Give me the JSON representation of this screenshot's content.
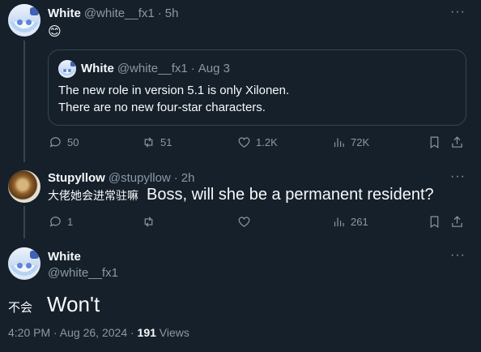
{
  "tweet1": {
    "name": "White",
    "handle": "@white__fx1",
    "separator": "·",
    "time": "5h",
    "text": "😊",
    "more": "···"
  },
  "quote": {
    "name": "White",
    "handle": "@white__fx1",
    "separator": "·",
    "time": "Aug 3",
    "line1": "The new role in version 5.1 is only Xilonen.",
    "line2": "There are no new four-star characters."
  },
  "tweet1_actions": {
    "replies": "50",
    "retweets": "51",
    "likes": "1.2K",
    "views": "72K"
  },
  "tweet2": {
    "name": "Stupyllow",
    "handle": "@stupyllow",
    "separator": "·",
    "time": "2h",
    "text_cn": "大佬她会进常驻嘛",
    "text_en": "Boss, will she be a permanent resident?",
    "more": "···"
  },
  "tweet2_actions": {
    "replies": "1",
    "retweets": "",
    "likes": "",
    "views": "261"
  },
  "main": {
    "name": "White",
    "handle": "@white__fx1",
    "text_cn": "不会",
    "text_en": "Won't",
    "more": "···",
    "timestamp": "4:20 PM · Aug 26, 2024 · ",
    "views_count": "191",
    "views_label": " Views"
  },
  "colors": {
    "background": "#15202b",
    "text": "#f7f9f9",
    "muted": "#8b98a5",
    "border": "#38444d"
  }
}
